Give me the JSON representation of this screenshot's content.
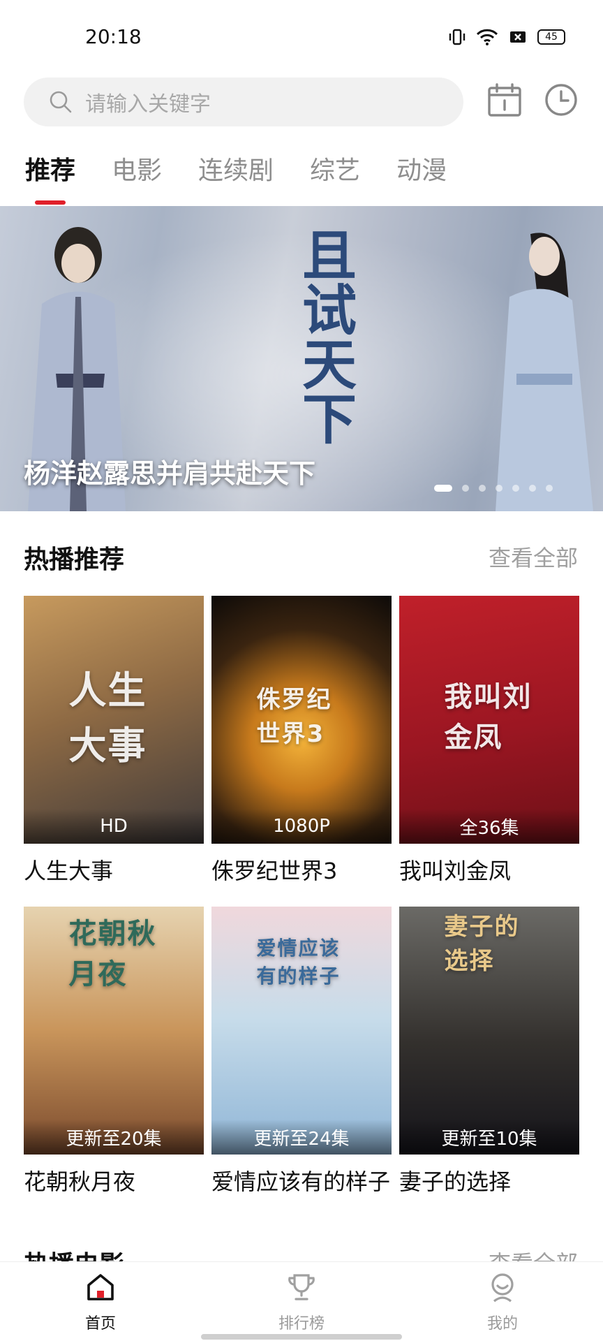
{
  "status_bar": {
    "time": "20:18",
    "battery": "45"
  },
  "search": {
    "placeholder": "请输入关键字"
  },
  "tabs": [
    {
      "label": "推荐",
      "active": true
    },
    {
      "label": "电影"
    },
    {
      "label": "连续剧"
    },
    {
      "label": "综艺"
    },
    {
      "label": "动漫"
    }
  ],
  "banner": {
    "caption": "杨洋赵露思并肩共赴天下",
    "art_text": "且试天下",
    "dot_count": 7,
    "active_dot": 0
  },
  "hot_section": {
    "title": "热播推荐",
    "more": "查看全部",
    "items": [
      {
        "title": "人生大事",
        "badge": "HD",
        "art": "人生大事"
      },
      {
        "title": "侏罗纪世界3",
        "badge": "1080P",
        "art": "侏罗纪世界3"
      },
      {
        "title": "我叫刘金凤",
        "badge": "全36集",
        "art": "我叫刘金凤"
      },
      {
        "title": "花朝秋月夜",
        "badge": "更新至20集",
        "art": "花朝秋月夜"
      },
      {
        "title": "爱情应该有的样子",
        "badge": "更新至24集",
        "art": "爱情应该有的样子"
      },
      {
        "title": "妻子的选择",
        "badge": "更新至10集",
        "art": "妻子的选择"
      }
    ]
  },
  "movie_section": {
    "title": "热播电影",
    "more": "查看全部"
  },
  "bottom_nav": [
    {
      "label": "首页",
      "icon": "home-icon",
      "active": true
    },
    {
      "label": "排行榜",
      "icon": "trophy-icon"
    },
    {
      "label": "我的",
      "icon": "profile-icon"
    }
  ],
  "colors": {
    "accent": "#e0202a",
    "muted": "#a0a0a0"
  }
}
